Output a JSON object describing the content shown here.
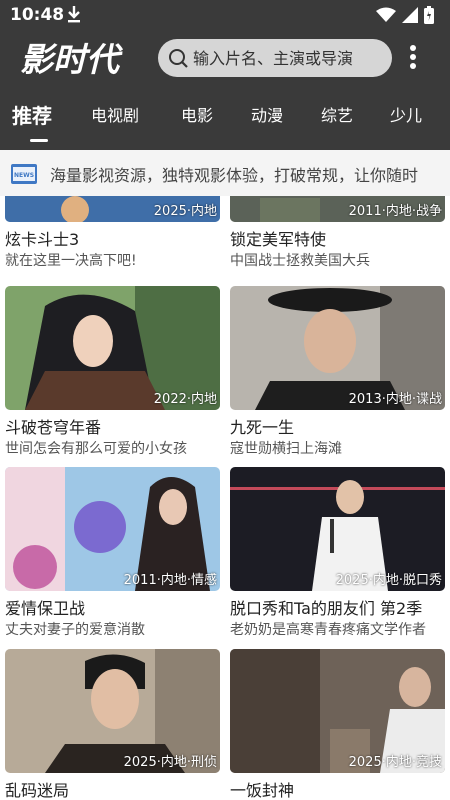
{
  "status": {
    "time": "10:48"
  },
  "app": {
    "logo_text": "影时代"
  },
  "search": {
    "placeholder": "输入片名、主演或导演"
  },
  "tabs": [
    {
      "label": "推荐"
    },
    {
      "label": "电视剧"
    },
    {
      "label": "电影"
    },
    {
      "label": "动漫"
    },
    {
      "label": "综艺"
    },
    {
      "label": "少儿"
    }
  ],
  "news": {
    "text": "海量影视资源，独特观影体验，打破常规，让你随时"
  },
  "cards": [
    {
      "title": "炫卡斗士3",
      "sub": "就在这里一决高下吧!",
      "meta": "2025·内地"
    },
    {
      "title": "锁定美军特使",
      "sub": "中国战士拯救美国大兵",
      "meta": "2011·内地·战争"
    },
    {
      "title": "斗破苍穹年番",
      "sub": "世间怎会有那么可爱的小女孩",
      "meta": "2022·内地"
    },
    {
      "title": "九死一生",
      "sub": "寇世勋横扫上海滩",
      "meta": "2013·内地·谍战"
    },
    {
      "title": "爱情保卫战",
      "sub": "丈夫对妻子的爱意消散",
      "meta": "2011·内地·情感"
    },
    {
      "title": "脱口秀和Ta的朋友们 第2季",
      "sub": "老奶奶是高寒青春疼痛文学作者",
      "meta": "2025·内地·脱口秀"
    },
    {
      "title": "乱码迷局",
      "sub": "",
      "meta": "2025·内地·刑侦"
    },
    {
      "title": "一饭封神",
      "sub": "",
      "meta": "2025·内地·竞技"
    }
  ],
  "colors": {
    "topbar": "#3a3a3a",
    "search_bg": "#d6d6d6"
  }
}
